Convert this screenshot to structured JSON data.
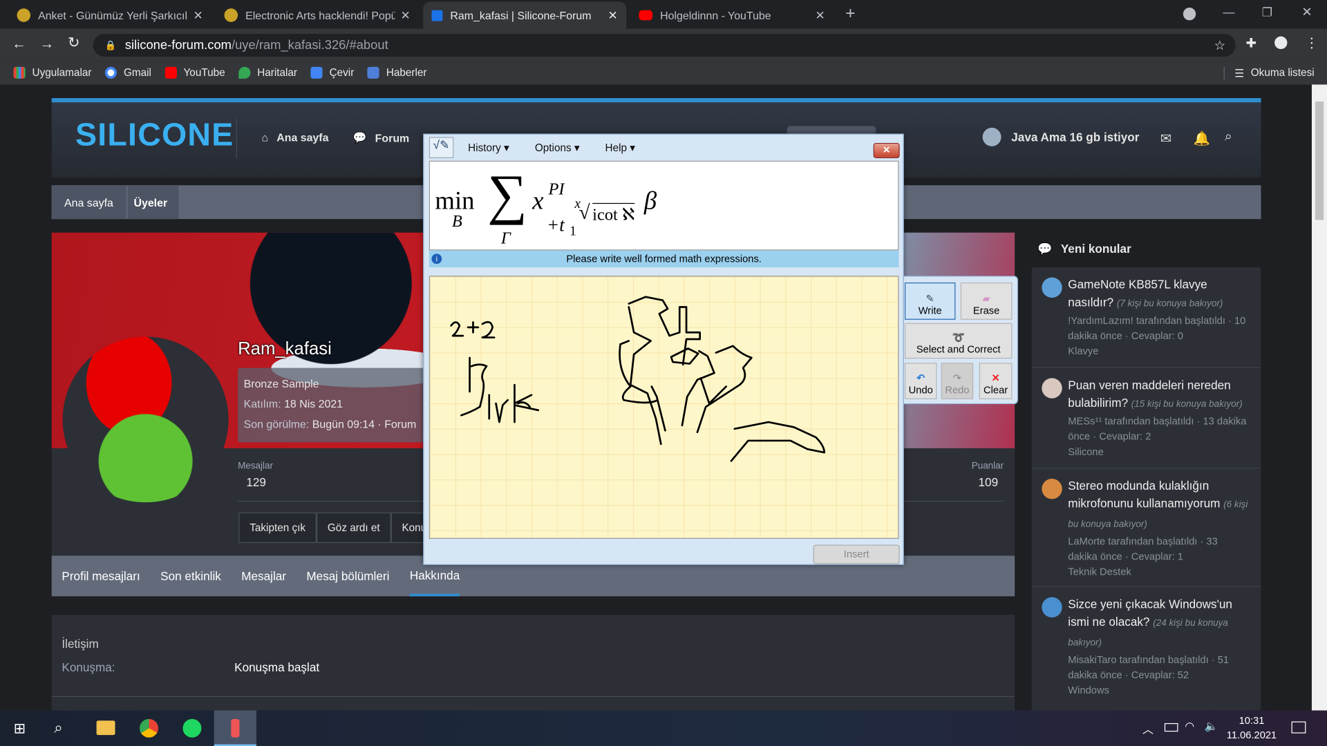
{
  "browser": {
    "tabs": [
      {
        "title": "Anket - Günümüz Yerli Şarkıcılar",
        "active": false
      },
      {
        "title": "Electronic Arts hacklendi! Popüler",
        "active": false
      },
      {
        "title": "Ram_kafasi | Silicone-Forum",
        "active": true
      },
      {
        "title": "Holgeldinnn - YouTube",
        "active": false
      }
    ],
    "url_host": "silicone-forum.com",
    "url_path": "/uye/ram_kafasi.326/#about",
    "bookmarks": [
      "Uygulamalar",
      "Gmail",
      "YouTube",
      "Haritalar",
      "Çevir",
      "Haberler"
    ],
    "reading_list": "Okuma listesi"
  },
  "site": {
    "logo": "SILICONE",
    "nav": [
      "Ana sayfa",
      "Forum"
    ],
    "user": "Java Ama 16 gb istiyor",
    "breadcrumb": [
      "Ana sayfa",
      "Üyeler"
    ]
  },
  "profile": {
    "username": "Ram_kafasi",
    "rank": "Bronze Sample",
    "joined_label": "Katılım:",
    "joined": "18 Nis 2021",
    "seen_label": "Son görülme:",
    "seen": "Bugün 09:14 · Forum",
    "stats": [
      {
        "label": "Mesajlar",
        "value": "129"
      },
      {
        "label": "Puanlar",
        "value": "109"
      }
    ],
    "buttons": [
      "Takipten çık",
      "Göz ardı et",
      "Konu"
    ],
    "tabs": [
      "Profil mesajları",
      "Son etkinlik",
      "Mesajlar",
      "Mesaj bölümleri",
      "Hakkında"
    ],
    "active_tab": "Hakkında",
    "section_title": "İletişim",
    "conversation_label": "Konuşma:",
    "conversation_link": "Konuşma başlat"
  },
  "sidebar": {
    "title": "Yeni konular",
    "threads": [
      {
        "title": "GameNote KB857L klavye nasıldır?",
        "viewers": "(7 kişi bu konuya bakıyor)",
        "meta": "!YardımLazım! tarafından başlatıldı · 10 dakika önce · Cevaplar: 0",
        "forum": "Klavye"
      },
      {
        "title": "Puan veren maddeleri nereden bulabilirim?",
        "viewers": "(15 kişi bu konuya bakıyor)",
        "meta": "MESs¹¹ tarafından başlatıldı · 13 dakika önce · Cevaplar: 2",
        "forum": "Silicone"
      },
      {
        "title": "Stereo modunda kulaklığın mikrofonunu kullanamıyorum",
        "viewers": "(6 kişi bu konuya bakıyor)",
        "meta": "LaMorte tarafından başlatıldı · 33 dakika önce · Cevaplar: 1",
        "forum": "Teknik Destek"
      },
      {
        "title": "Sizce yeni çıkacak Windows'un ismi ne olacak?",
        "viewers": "(24 kişi bu konuya bakıyor)",
        "meta": "MisakiTaro tarafından başlatıldı · 51 dakika önce · Cevaplar: 52",
        "forum": "Windows"
      }
    ]
  },
  "math_panel": {
    "menus": [
      "History",
      "Options",
      "Help"
    ],
    "status": "Please write well formed math expressions.",
    "tools": {
      "write": "Write",
      "erase": "Erase",
      "select": "Select and Correct",
      "undo": "Undo",
      "redo": "Redo",
      "clear": "Clear"
    },
    "insert": "Insert",
    "close": "✕",
    "result": {
      "min": "min",
      "sub": "B",
      "sigma": "∑",
      "sigma_sub": "Γ",
      "x": "x",
      "sup": "PI",
      "plus_t": "+t",
      "t_sub": "1",
      "root_index": "x",
      "radicand": "icot ℵ",
      "beta": "β"
    }
  },
  "taskbar": {
    "time": "10:31",
    "date": "11.06.2021"
  },
  "colors": {
    "accent": "#2f8fd0",
    "banner_red": "#c81c24",
    "ink_bg": "#fdf6c9"
  }
}
